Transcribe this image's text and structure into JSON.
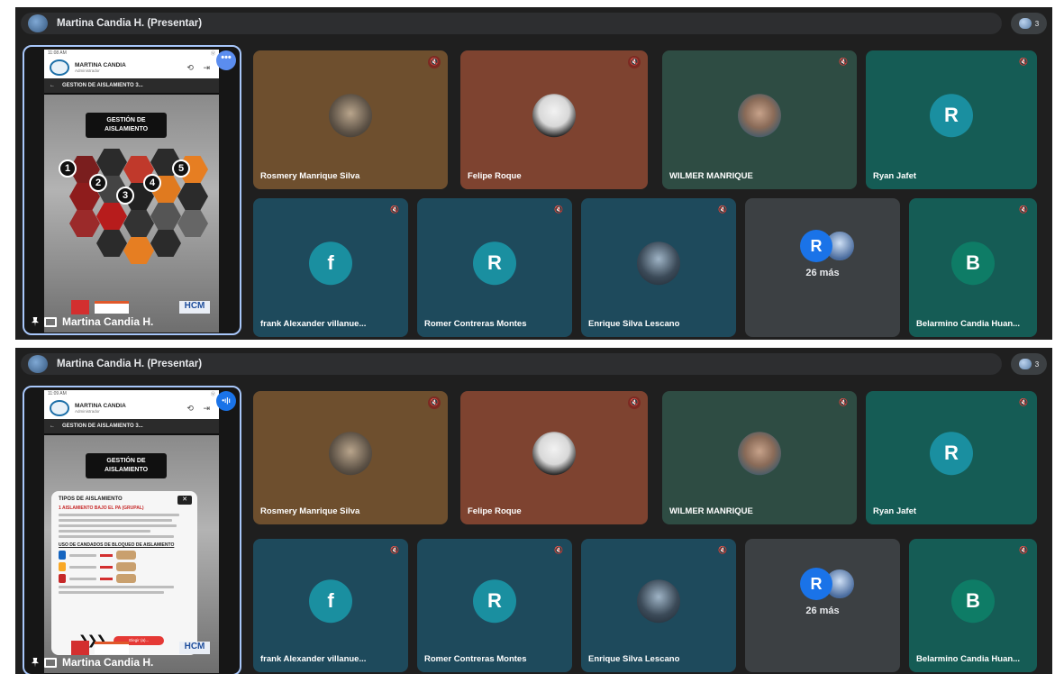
{
  "colors": {
    "accent": "#a8c7fa",
    "tile_brown": "#6e4f2e",
    "tile_rust": "#7e4330",
    "tile_green": "#2e4c43",
    "tile_teal": "#155c55",
    "tile_blue": "#1e4a5c",
    "tile_gray": "#3c4043",
    "avatar_teal": "#1a8fa0",
    "avatar_dark": "#3a4a4e",
    "avatar_green": "#0e7c66"
  },
  "panels": [
    {
      "presenter_title": "Martina Candia H. (Presentar)",
      "people_count": "3",
      "more_button": "•••",
      "phone": {
        "status_time": "11:08 AM",
        "status_right": "Ⓥ",
        "app_name": "MARTINA CANDIA",
        "app_role": "Administrador",
        "header_icons": "⟲ ⇥",
        "nav_back": "←",
        "nav_title": "GESTION DE AISLAMIENTO 3...",
        "heading_line1": "GESTIÓN DE",
        "heading_line2": "AISLAMIENTO",
        "numbers": [
          "1",
          "2",
          "3",
          "4",
          "5"
        ],
        "brand_text": "HCM",
        "presenter_name": "Martina Candia H."
      },
      "tiles": [
        {
          "name": "Rosmery Manrique Silva",
          "mic": "🔇",
          "type": "photo"
        },
        {
          "name": "Felipe Roque",
          "mic": "🔇",
          "type": "photo"
        },
        {
          "name": "WILMER MANRIQUE",
          "mic": "🔇",
          "type": "photo"
        },
        {
          "name": "Ryan Jafet",
          "mic": "🔇",
          "type": "letter",
          "letter": "R"
        },
        {
          "name": "frank Alexander villanue...",
          "mic": "🔇",
          "type": "letter",
          "letter": "f"
        },
        {
          "name": "Romer Contreras Montes",
          "mic": "🔇",
          "type": "letter",
          "letter": "R"
        },
        {
          "name": "Enrique Silva Lescano",
          "mic": "🔇",
          "type": "photo"
        },
        {
          "name": "",
          "mic": "",
          "type": "more",
          "letter": "R",
          "more_text": "26 más"
        },
        {
          "name": "Belarmino Candia Huan...",
          "mic": "🔇",
          "type": "letter",
          "letter": "B"
        }
      ]
    },
    {
      "presenter_title": "Martina Candia H. (Presentar)",
      "people_count": "3",
      "more_button": "•ı|ı",
      "phone": {
        "status_time": "11:09 AM",
        "status_right": "Ⓥ",
        "app_name": "MARTINA CANDIA",
        "app_role": "Administrador",
        "header_icons": "⟲ ⇥",
        "nav_back": "←",
        "nav_title": "GESTION DE AISLAMIENTO 3...",
        "heading_line1": "GESTIÓN DE",
        "heading_line2": "AISLAMIENTO",
        "modal_title": "TIPOS DE AISLAMIENTO",
        "modal_close": "✕",
        "modal_red": "1  AISLAMIENTO BAJO EL PA (GRUPAL)",
        "modal_sub": "USO DE CANDADOS DE BLOQUEO DE AISLAMIENTO",
        "modal_button": "Elegir (a)...",
        "modal_chevrons": "❯❯❯",
        "brand_text": "HCM",
        "presenter_name": "Martina Candia H."
      },
      "tiles": [
        {
          "name": "Rosmery Manrique Silva",
          "mic": "🔇",
          "type": "photo"
        },
        {
          "name": "Felipe Roque",
          "mic": "🔇",
          "type": "photo"
        },
        {
          "name": "WILMER MANRIQUE",
          "mic": "🔇",
          "type": "photo"
        },
        {
          "name": "Ryan Jafet",
          "mic": "🔇",
          "type": "letter",
          "letter": "R"
        },
        {
          "name": "frank Alexander villanue...",
          "mic": "🔇",
          "type": "letter",
          "letter": "f"
        },
        {
          "name": "Romer Contreras Montes",
          "mic": "🔇",
          "type": "letter",
          "letter": "R"
        },
        {
          "name": "Enrique Silva Lescano",
          "mic": "🔇",
          "type": "photo"
        },
        {
          "name": "",
          "mic": "",
          "type": "more",
          "letter": "R",
          "more_text": "26 más"
        },
        {
          "name": "Belarmino Candia Huan...",
          "mic": "🔇",
          "type": "letter",
          "letter": "B"
        }
      ]
    }
  ]
}
